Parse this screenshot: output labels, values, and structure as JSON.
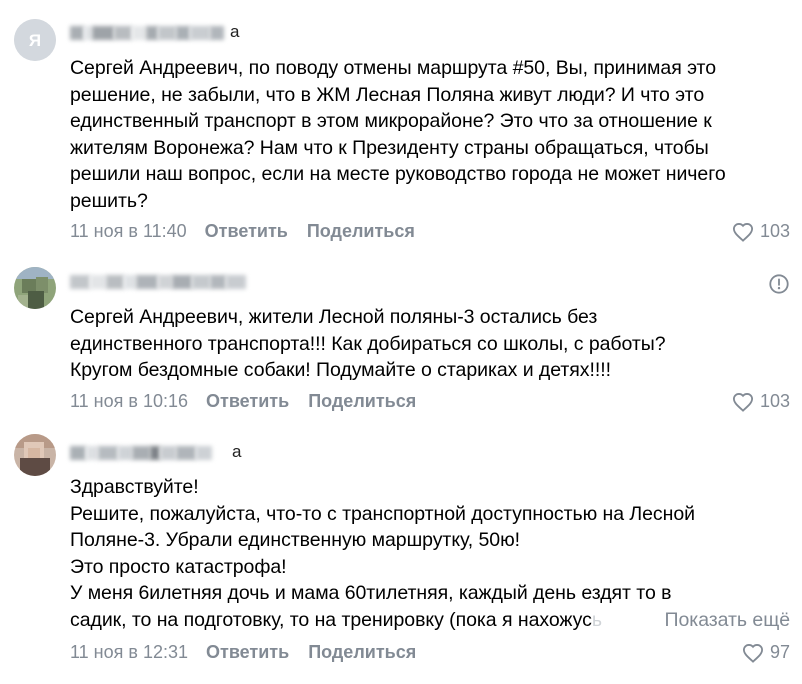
{
  "comments": [
    {
      "author_tail": "а",
      "lines": [
        "Сергей Андреевич, по поводу отмены маршрута #50, Вы, принимая это",
        "решение, не забыли, что в ЖМ Лесная Поляна живут люди? И что это",
        "единственный транспорт в этом микрорайоне? Это что за отношение к",
        "жителям Воронежа? Нам что к Президенту страны обращаться, чтобы",
        "решили наш вопрос, если на месте руководство города не может ничего",
        "решить?"
      ],
      "date": "11 ноя в 11:40",
      "reply_label": "Ответить",
      "share_label": "Поделиться",
      "likes": "103"
    },
    {
      "author_tail": "",
      "lines": [
        "Сергей Андреевич, жители Лесной поляны-3 остались без",
        "единственного транспорта!!! Как добираться со школы, с работы?",
        "Кругом бездомные собаки! Подумайте о стариках и детях!!!!"
      ],
      "date": "11 ноя в 10:16",
      "reply_label": "Ответить",
      "share_label": "Поделиться",
      "likes": "103"
    },
    {
      "author_tail": "а",
      "lines": [
        "Здравствуйте!",
        "Решите, пожалуйста, что-то с транспортной доступностью на Лесной",
        "Поляне-3. Убрали единственную маршрутку, 50ю!",
        "Это просто катастрофа!",
        "У меня 6илетняя дочь и мама 60тилетняя, каждый день ездят то в"
      ],
      "last_line": "садик, то на подготовку, то на тренировку (пока я нахожус",
      "last_line_fade": "ь",
      "show_more": "Показать ещё",
      "date": "11 ноя в 12:31",
      "reply_label": "Ответить",
      "share_label": "Поделиться",
      "likes": "97"
    }
  ],
  "icons": {
    "heart": "heart-icon",
    "report": "report-icon"
  }
}
